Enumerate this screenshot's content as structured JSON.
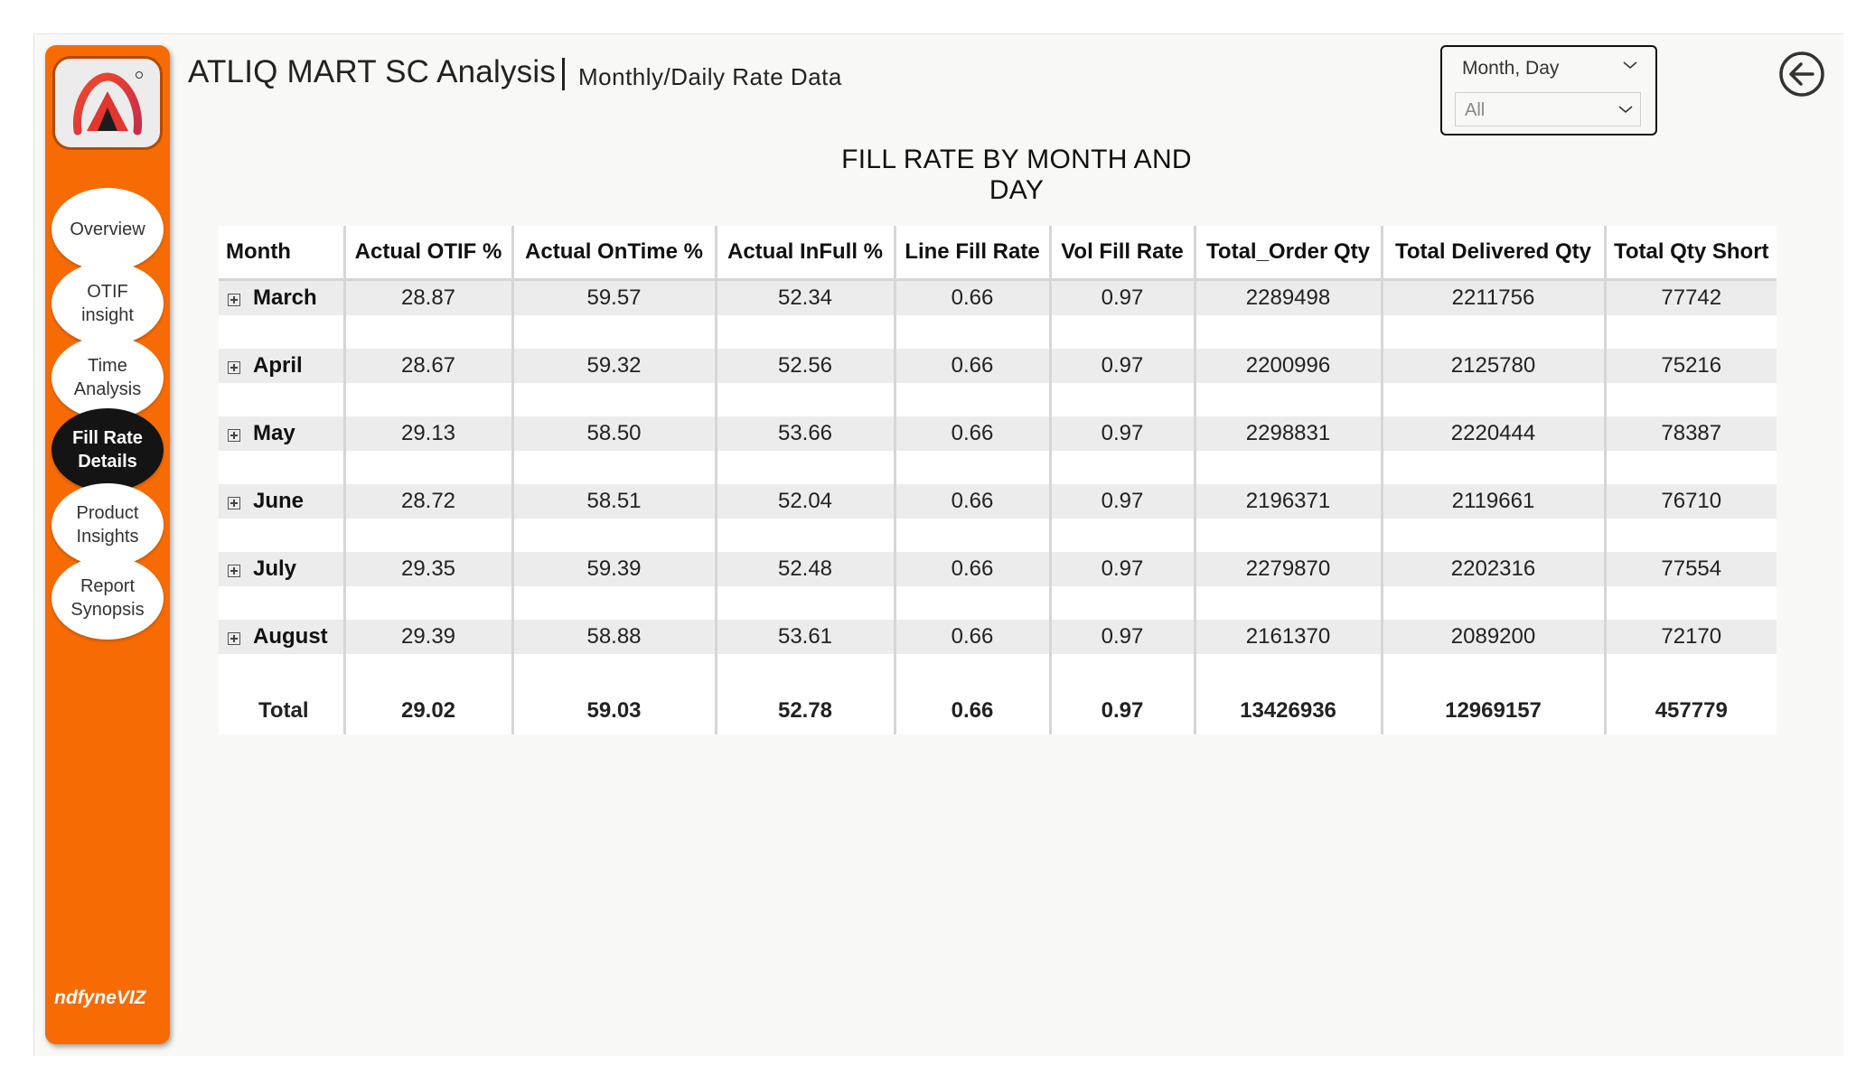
{
  "header": {
    "title": "ATLIQ MART SC Analysis",
    "subtitle": "Monthly/Daily Rate Data"
  },
  "slicer": {
    "label": "Month, Day",
    "value": "All"
  },
  "sidebar": {
    "items": [
      {
        "label": "Overview",
        "active": false
      },
      {
        "label": "OTIF\ninsight",
        "active": false
      },
      {
        "label": "Time\nAnalysis",
        "active": false
      },
      {
        "label": "Fill Rate\nDetails",
        "active": true
      },
      {
        "label": "Product\nInsights",
        "active": false
      },
      {
        "label": "Report\nSynopsis",
        "active": false
      }
    ],
    "brand": "ndfyneVIZ"
  },
  "colors": {
    "sidebar": "#f76b05",
    "active_nav": "#141414",
    "row_band": "#ececec"
  },
  "table": {
    "title": "FILL RATE BY MONTH AND DAY",
    "columns": [
      "Month",
      "Actual OTIF %",
      "Actual OnTime %",
      "Actual InFull %",
      "Line Fill Rate",
      "Vol Fill Rate",
      "Total_Order Qty",
      "Total Delivered Qty",
      "Total Qty Short"
    ],
    "rows": [
      [
        "March",
        "28.87",
        "59.57",
        "52.34",
        "0.66",
        "0.97",
        "2289498",
        "2211756",
        "77742"
      ],
      [
        "April",
        "28.67",
        "59.32",
        "52.56",
        "0.66",
        "0.97",
        "2200996",
        "2125780",
        "75216"
      ],
      [
        "May",
        "29.13",
        "58.50",
        "53.66",
        "0.66",
        "0.97",
        "2298831",
        "2220444",
        "78387"
      ],
      [
        "June",
        "28.72",
        "58.51",
        "52.04",
        "0.66",
        "0.97",
        "2196371",
        "2119661",
        "76710"
      ],
      [
        "July",
        "29.35",
        "59.39",
        "52.48",
        "0.66",
        "0.97",
        "2279870",
        "2202316",
        "77554"
      ],
      [
        "August",
        "29.39",
        "58.88",
        "53.61",
        "0.66",
        "0.97",
        "2161370",
        "2089200",
        "72170"
      ]
    ],
    "total": [
      "Total",
      "29.02",
      "59.03",
      "52.78",
      "0.66",
      "0.97",
      "13426936",
      "12969157",
      "457779"
    ]
  }
}
